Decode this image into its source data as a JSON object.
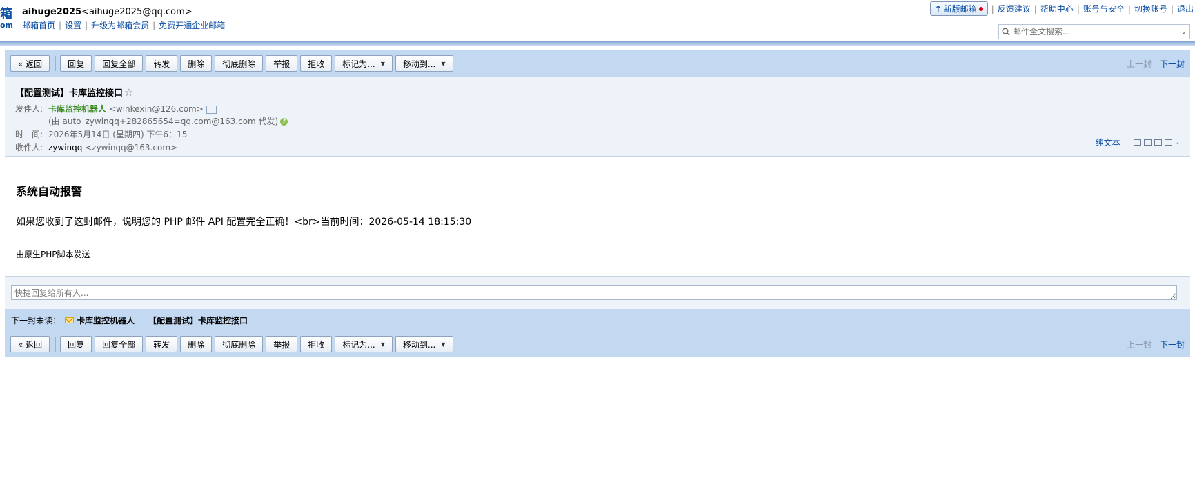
{
  "header": {
    "logo_partial_top": "箱",
    "logo_partial_bottom": "om",
    "account_name": "aihuge2025",
    "account_email": "<aihuge2025@qq.com>",
    "links": [
      "邮箱首页",
      "设置",
      "升级为邮箱会员",
      "免费开通企业邮箱"
    ],
    "new_mail_label": "新版邮箱",
    "top_links": [
      "反馈建议",
      "帮助中心",
      "账号与安全",
      "切换账号",
      "退出"
    ],
    "search_placeholder": "邮件全文搜索..."
  },
  "toolbar": {
    "back": "« 返回",
    "reply": "回复",
    "reply_all": "回复全部",
    "forward": "转发",
    "delete": "删除",
    "delete_perm": "彻底删除",
    "report": "举报",
    "reject": "拒收",
    "mark_as": "标记为...",
    "move_to": "移动到...",
    "prev": "上一封",
    "next": "下一封"
  },
  "mail": {
    "subject": "【配置测试】卡库监控接口",
    "star": "☆",
    "from_label": "发件人:",
    "from_name": "卡库监控机器人",
    "from_email": "<winkexin@126.com>",
    "on_behalf": "(由 auto_zywinqq+282865654=qq.com@163.com 代发)",
    "time_label": "时　间:",
    "time_value": "2026年5月14日 (星期四) 下午6：15",
    "to_label": "收件人:",
    "to_name": "zywinqq",
    "to_email": "<zywinqq@163.com>",
    "plain_text": "纯文本"
  },
  "body": {
    "title": "系统自动报警",
    "text_prefix": "如果您收到了这封邮件，说明您的 PHP 邮件 API 配置完全正确！<br>当前时间：",
    "date": "2026-05-14",
    "time": " 18:15:30",
    "footer": "由原生PHP脚本发送"
  },
  "quick_reply_placeholder": "快捷回复给所有人...",
  "next_unread": {
    "label": "下一封未读：",
    "from": "卡库监控机器人",
    "subject": "【配置测试】卡库监控接口"
  },
  "colors": {
    "toolbar_bg": "#c3d8f1",
    "head_bg": "#eef3fa",
    "link": "#0b4ea2",
    "sender": "#3b8a1f"
  }
}
